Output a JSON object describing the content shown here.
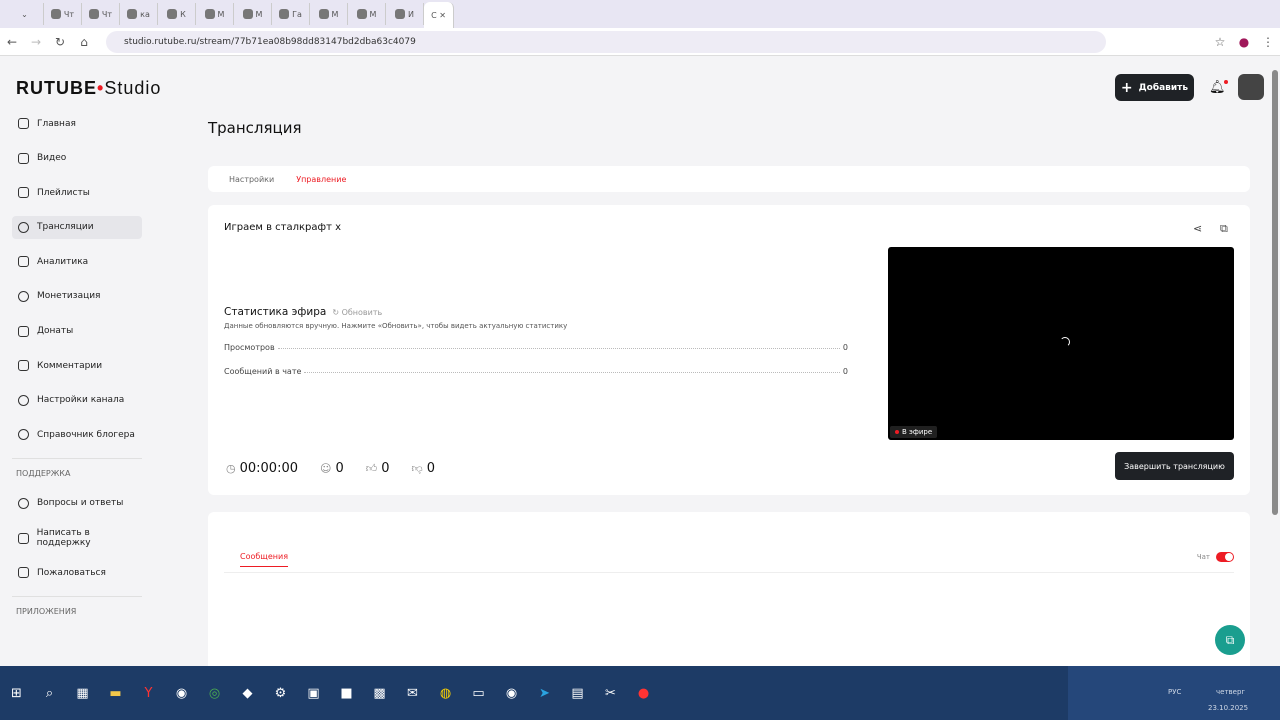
{
  "browser": {
    "active_tab_label": "С",
    "url": "studio.rutube.ru/stream/77b71ea08b98dd83147bd2dba63c4079",
    "tab_labels": [
      "Чт",
      "Чт",
      "ка",
      "К",
      "М",
      "М",
      "Га",
      "М",
      "М",
      "И"
    ]
  },
  "logo": {
    "brand": "RUTUBE",
    "suffix": "Studio"
  },
  "sidebar": {
    "items": [
      {
        "label": "Главная"
      },
      {
        "label": "Видео"
      },
      {
        "label": "Плейлисты"
      },
      {
        "label": "Трансляции"
      },
      {
        "label": "Аналитика"
      },
      {
        "label": "Монетизация"
      },
      {
        "label": "Донаты"
      },
      {
        "label": "Комментарии"
      },
      {
        "label": "Настройки канала"
      },
      {
        "label": "Справочник блогера"
      }
    ],
    "support_heading": "ПОДДЕРЖКА",
    "support_items": [
      {
        "label": "Вопросы и ответы"
      },
      {
        "label": "Написать в поддержку"
      },
      {
        "label": "Пожаловаться"
      }
    ],
    "apps_heading": "ПРИЛОЖЕНИЯ"
  },
  "header": {
    "add_label": "Добавить"
  },
  "page": {
    "title": "Трансляция",
    "tabs": [
      "Настройки",
      "Управление"
    ]
  },
  "stream": {
    "title": "Играем в сталкрафт х",
    "stats_heading": "Статистика эфира",
    "refresh_label": "Обновить",
    "note": "Данные обновляются вручную. Нажмите «Обновить», чтобы видеть актуальную статистику",
    "stats": [
      {
        "label": "Просмотров",
        "value": "0"
      },
      {
        "label": "Сообщений в чате",
        "value": "0"
      }
    ],
    "live_label": "В эфире",
    "timer": "00:00:00",
    "viewers": "0",
    "likes": "0",
    "dislikes": "0",
    "end_label": "Завершить трансляцию"
  },
  "chat": {
    "messages_tab": "Сообщения",
    "chat_label": "Чат",
    "chat_enabled": true
  },
  "tray": {
    "lang": "РУС",
    "day": "четверг",
    "date": "23.10.2025"
  },
  "colors": {
    "accent": "#ed1c24",
    "dark": "#1f2226"
  }
}
